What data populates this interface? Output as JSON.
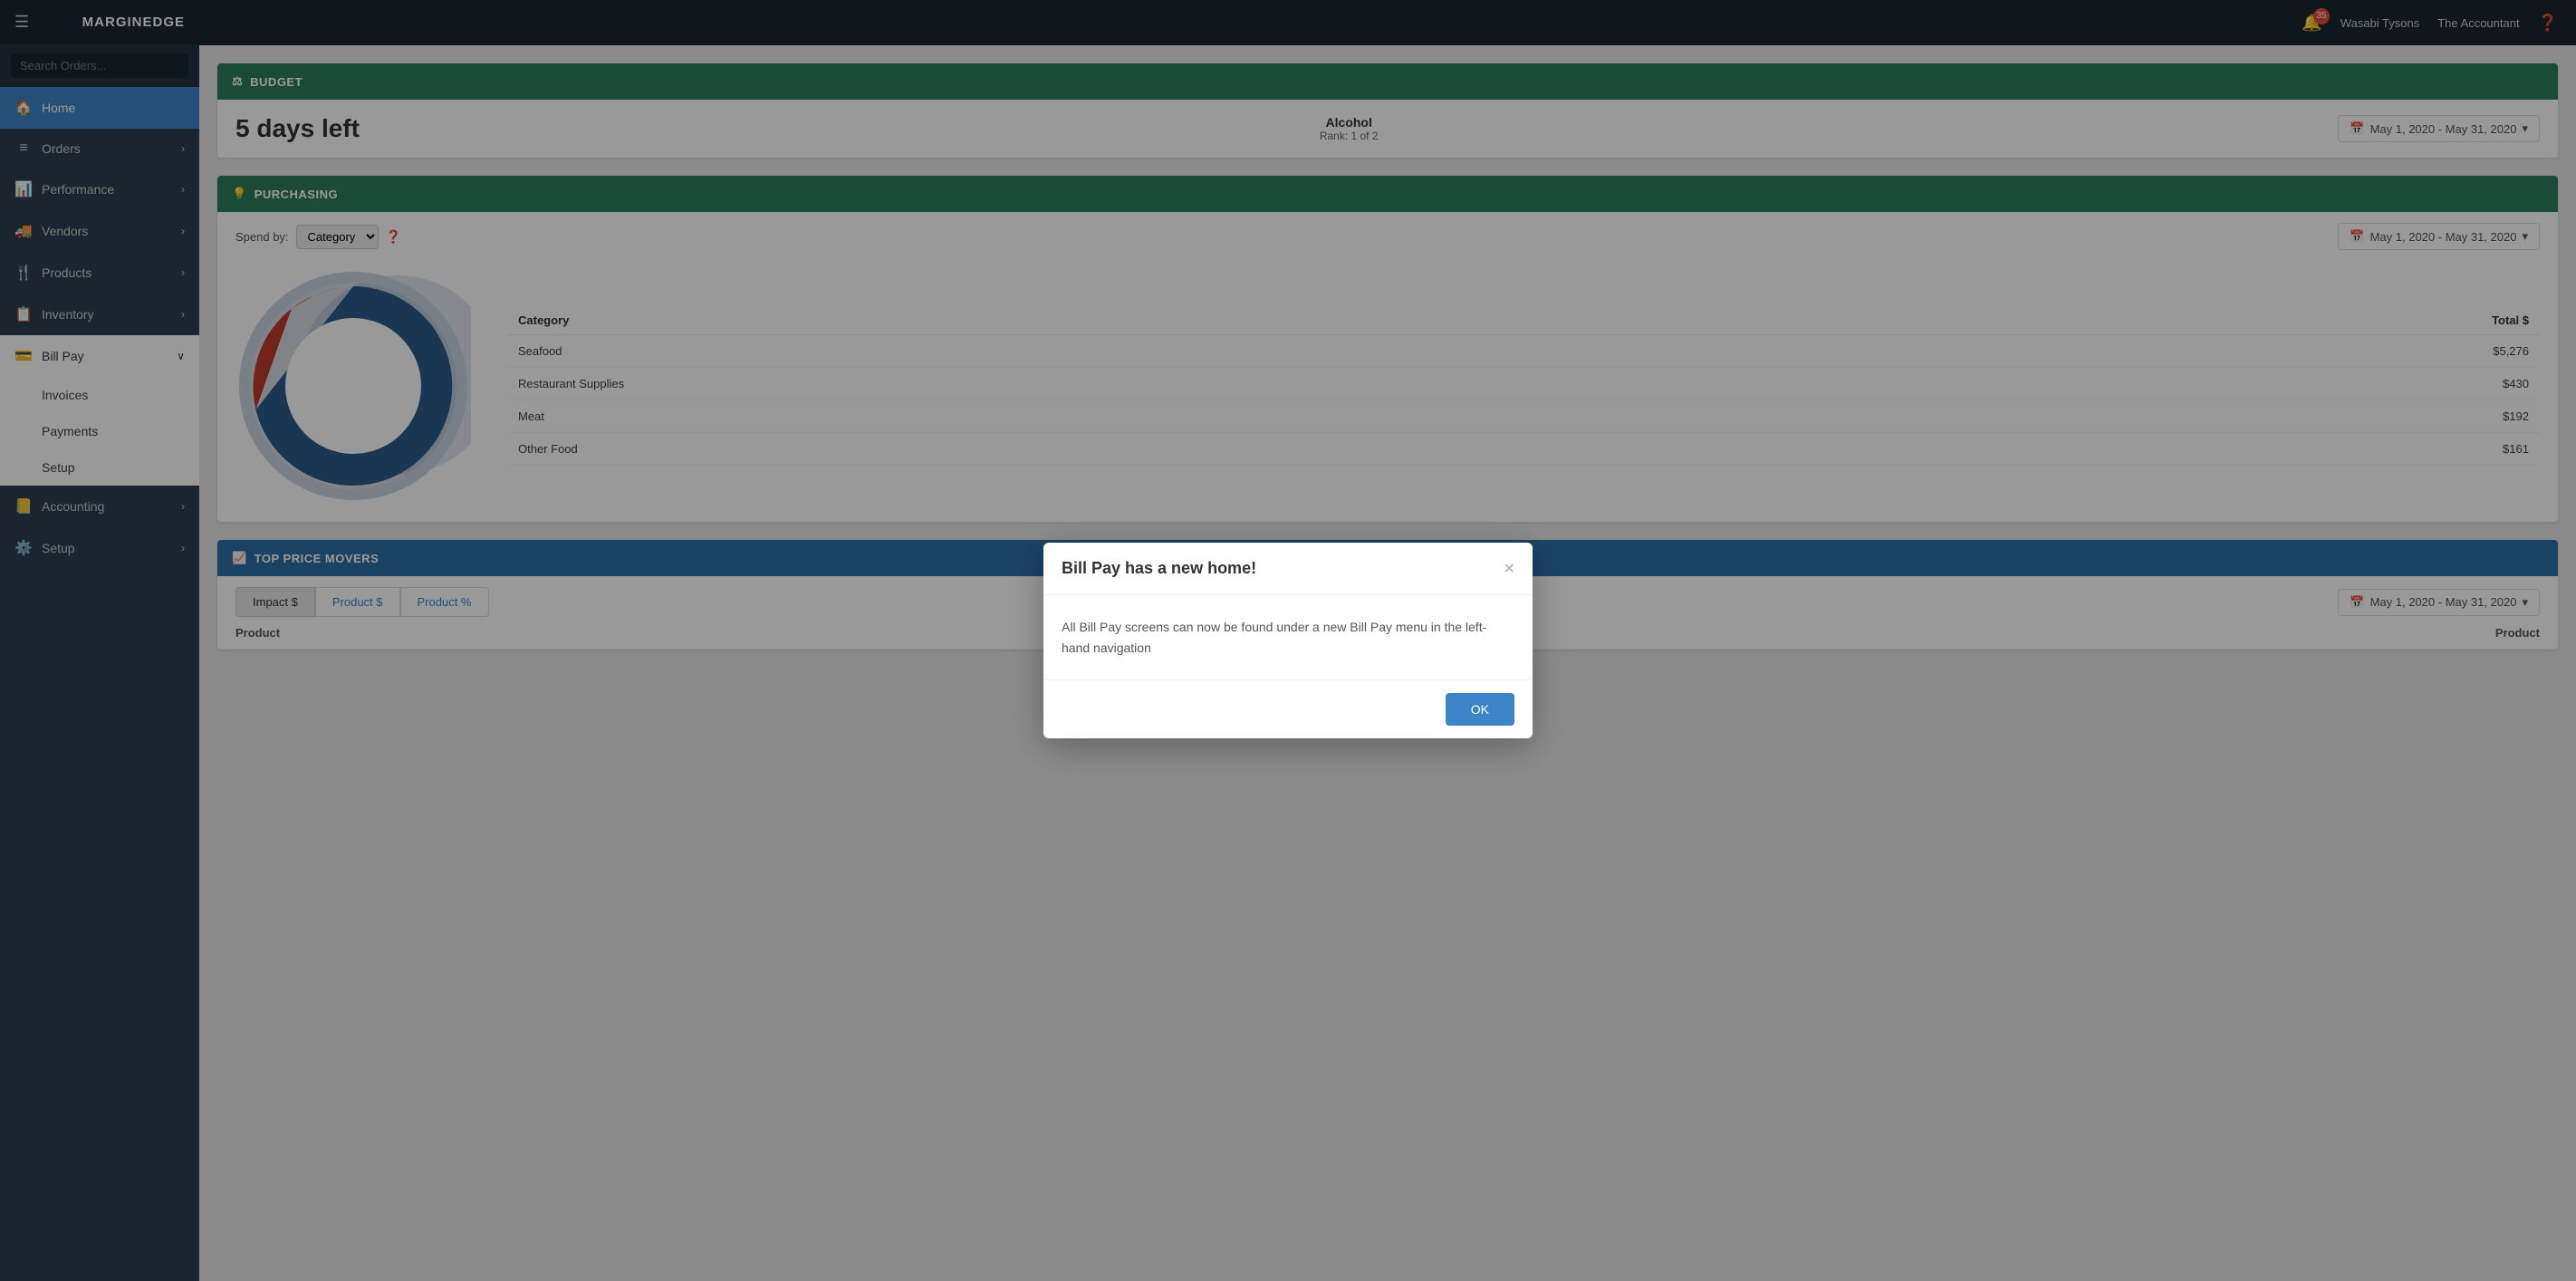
{
  "app": {
    "name": "MARGINEDGE",
    "hamburger_icon": "☰"
  },
  "topbar": {
    "notification_count": "35",
    "user": "Wasabi Tysons",
    "account": "The Accountant",
    "help_icon": "?"
  },
  "sidebar": {
    "search_placeholder": "Search Orders...",
    "items": [
      {
        "id": "home",
        "label": "Home",
        "icon": "🏠",
        "active": true
      },
      {
        "id": "orders",
        "label": "Orders",
        "icon": "☰",
        "arrow": true
      },
      {
        "id": "performance",
        "label": "Performance",
        "icon": "📊",
        "arrow": true
      },
      {
        "id": "vendors",
        "label": "Vendors",
        "icon": "🚚",
        "arrow": true
      },
      {
        "id": "products",
        "label": "Products",
        "icon": "🍴",
        "arrow": true
      },
      {
        "id": "inventory",
        "label": "Inventory",
        "icon": "📋",
        "arrow": true
      },
      {
        "id": "billpay",
        "label": "Bill Pay",
        "icon": "💳",
        "arrow": true,
        "expanded": true
      },
      {
        "id": "accounting",
        "label": "Accounting",
        "icon": "📒",
        "arrow": true
      },
      {
        "id": "setup",
        "label": "Setup",
        "icon": "⚙️",
        "arrow": true
      }
    ],
    "bill_pay_sub": [
      {
        "id": "invoices",
        "label": "Invoices"
      },
      {
        "id": "payments",
        "label": "Payments"
      },
      {
        "id": "setup",
        "label": "Setup"
      }
    ]
  },
  "budget": {
    "section_icon": "⚖",
    "section_label": "BUDGET",
    "days_left": "5 days left",
    "category": "Alcohol",
    "rank": "Rank: 1 of 2",
    "date_range": "May 1, 2020 - May 31, 2020"
  },
  "purchasing": {
    "section_icon": "💡",
    "section_label": "PURCHASING",
    "spend_by_label": "Spend by:",
    "category_option": "Category",
    "date_range": "May 1, 2020 - May 31, 2020",
    "chart": {
      "categories": [
        {
          "name": "Seafood",
          "total": "$5,276",
          "color": "#2b5c8a",
          "pct": 85
        },
        {
          "name": "Restaurant Supplies",
          "total": "$430",
          "color": "#c0392b",
          "pct": 7
        },
        {
          "name": "Meat",
          "total": "$192",
          "color": "#e67e22",
          "pct": 3
        },
        {
          "name": "Other Food",
          "total": "$161",
          "color": "#95a5a6",
          "pct": 2.5
        }
      ],
      "col_category": "Category",
      "col_total": "Total $"
    }
  },
  "price_movers": {
    "section_icon": "📈",
    "section_label": "TOP PRICE MOVERS",
    "tabs": [
      {
        "id": "impact",
        "label": "Impact $",
        "active": true
      },
      {
        "id": "product_dollar",
        "label": "Product $"
      },
      {
        "id": "product_pct",
        "label": "Product %"
      }
    ],
    "date_range": "May 1, 2020 - May 31, 2020",
    "col_product": "Product",
    "col_product2": "Product"
  },
  "modal": {
    "title": "Bill Pay has a new home!",
    "body": "All Bill Pay screens can now be found under a new Bill Pay menu in the left-hand navigation",
    "ok_label": "OK",
    "close_icon": "×"
  }
}
